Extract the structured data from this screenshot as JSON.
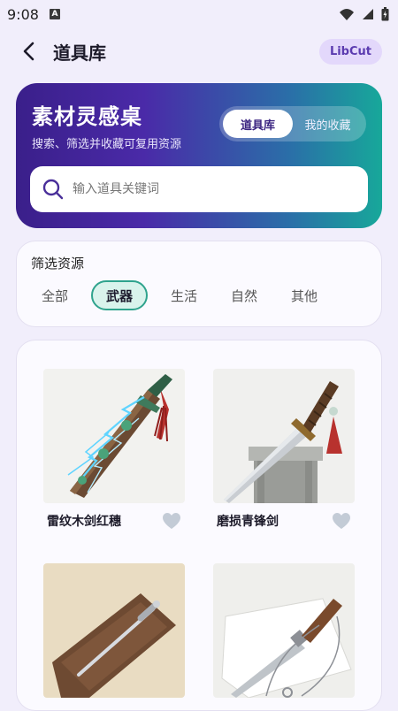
{
  "status": {
    "time": "9:08",
    "notif_letter": "A"
  },
  "header": {
    "title": "道具库",
    "badge": "LibCut"
  },
  "hero": {
    "title": "素材灵感桌",
    "subtitle": "搜索、筛选并收藏可复用资源",
    "tabs": [
      {
        "label": "道具库",
        "active": true
      },
      {
        "label": "我的收藏",
        "active": false
      }
    ],
    "search_placeholder": "输入道具关键词"
  },
  "filter": {
    "title": "筛选资源",
    "chips": [
      {
        "label": "全部",
        "active": false
      },
      {
        "label": "武器",
        "active": true
      },
      {
        "label": "生活",
        "active": false
      },
      {
        "label": "自然",
        "active": false
      },
      {
        "label": "其他",
        "active": false
      }
    ]
  },
  "items": [
    {
      "name": "雷纹木剑红穗",
      "icon": "heart-icon"
    },
    {
      "name": "磨损青锋剑",
      "icon": "heart-icon"
    },
    {
      "name": "",
      "icon": ""
    },
    {
      "name": "",
      "icon": ""
    }
  ],
  "colors": {
    "accent": "#2fa38d",
    "brand": "#5b3bb0",
    "background": "#f1eefb"
  }
}
